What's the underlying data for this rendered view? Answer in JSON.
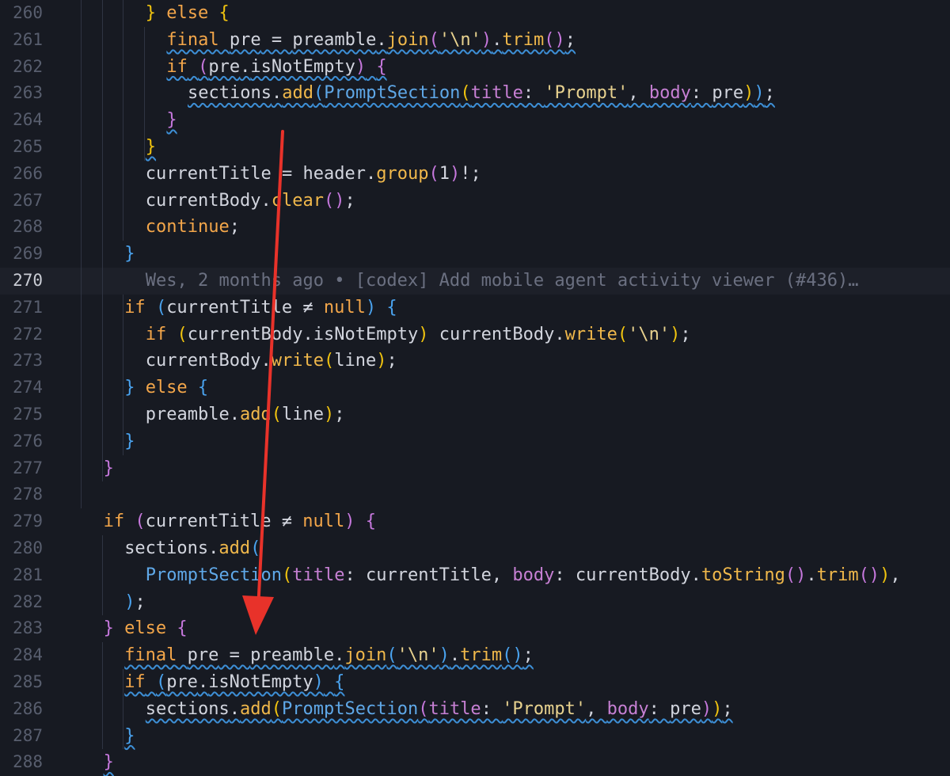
{
  "editor": {
    "current_line": 270,
    "lines": [
      {
        "num": "260",
        "indent": 3,
        "tokens": [
          [
            "br1",
            "}"
          ],
          [
            "sp",
            " "
          ],
          [
            "kw",
            "else"
          ],
          [
            "sp",
            " "
          ],
          [
            "br1",
            "{"
          ]
        ]
      },
      {
        "num": "261",
        "indent": 4,
        "sq": true,
        "tokens": [
          [
            "kw",
            "final"
          ],
          [
            "sp",
            " "
          ],
          [
            "id",
            "pre"
          ],
          [
            "op",
            " = "
          ],
          [
            "id",
            "preamble"
          ],
          [
            "punc",
            "."
          ],
          [
            "fn",
            "join"
          ],
          [
            "br2",
            "("
          ],
          [
            "str",
            "'\\n'"
          ],
          [
            "br2",
            ")"
          ],
          [
            "punc",
            "."
          ],
          [
            "fn",
            "trim"
          ],
          [
            "br2",
            "()"
          ],
          [
            "punc",
            ";"
          ]
        ]
      },
      {
        "num": "262",
        "indent": 4,
        "sq": true,
        "tokens": [
          [
            "kw",
            "if"
          ],
          [
            "sp",
            " "
          ],
          [
            "br2",
            "("
          ],
          [
            "id",
            "pre"
          ],
          [
            "punc",
            "."
          ],
          [
            "id",
            "isNotEmpty"
          ],
          [
            "br2",
            ")"
          ],
          [
            "sp",
            " "
          ],
          [
            "br2",
            "{"
          ]
        ]
      },
      {
        "num": "263",
        "indent": 5,
        "sq": true,
        "tokens": [
          [
            "id",
            "sections"
          ],
          [
            "punc",
            "."
          ],
          [
            "fn",
            "add"
          ],
          [
            "br3",
            "("
          ],
          [
            "type",
            "PromptSection"
          ],
          [
            "br1",
            "("
          ],
          [
            "prop",
            "title"
          ],
          [
            "punc",
            ": "
          ],
          [
            "str",
            "'Prompt'"
          ],
          [
            "punc",
            ", "
          ],
          [
            "prop",
            "body"
          ],
          [
            "punc",
            ": "
          ],
          [
            "id",
            "pre"
          ],
          [
            "br1",
            ")"
          ],
          [
            "br3",
            ")"
          ],
          [
            "punc",
            ";"
          ]
        ]
      },
      {
        "num": "264",
        "indent": 4,
        "sq": true,
        "tokens": [
          [
            "br2",
            "}"
          ]
        ]
      },
      {
        "num": "265",
        "indent": 3,
        "sq": true,
        "tokens": [
          [
            "br1",
            "}"
          ]
        ]
      },
      {
        "num": "266",
        "indent": 3,
        "tokens": [
          [
            "id",
            "currentTitle"
          ],
          [
            "op",
            " = "
          ],
          [
            "id",
            "header"
          ],
          [
            "punc",
            "."
          ],
          [
            "fn",
            "group"
          ],
          [
            "br2",
            "("
          ],
          [
            "id",
            "1"
          ],
          [
            "br2",
            ")"
          ],
          [
            "punc",
            "!;"
          ]
        ]
      },
      {
        "num": "267",
        "indent": 3,
        "tokens": [
          [
            "id",
            "currentBody"
          ],
          [
            "punc",
            "."
          ],
          [
            "fn",
            "clear"
          ],
          [
            "br2",
            "()"
          ],
          [
            "punc",
            ";"
          ]
        ]
      },
      {
        "num": "268",
        "indent": 3,
        "tokens": [
          [
            "kw",
            "continue"
          ],
          [
            "punc",
            ";"
          ]
        ]
      },
      {
        "num": "269",
        "indent": 2,
        "tokens": [
          [
            "br3",
            "}"
          ]
        ]
      },
      {
        "num": "270",
        "indent": 3,
        "tokens": [
          [
            "blame",
            "Wes, 2 months ago • [codex] Add mobile agent activity viewer (#436)…"
          ]
        ]
      },
      {
        "num": "271",
        "indent": 2,
        "tokens": [
          [
            "kw",
            "if"
          ],
          [
            "sp",
            " "
          ],
          [
            "br3",
            "("
          ],
          [
            "id",
            "currentTitle"
          ],
          [
            "op",
            " ≠ "
          ],
          [
            "kw",
            "null"
          ],
          [
            "br3",
            ")"
          ],
          [
            "sp",
            " "
          ],
          [
            "br3",
            "{"
          ]
        ]
      },
      {
        "num": "272",
        "indent": 3,
        "tokens": [
          [
            "kw",
            "if"
          ],
          [
            "sp",
            " "
          ],
          [
            "br1",
            "("
          ],
          [
            "id",
            "currentBody"
          ],
          [
            "punc",
            "."
          ],
          [
            "id",
            "isNotEmpty"
          ],
          [
            "br1",
            ")"
          ],
          [
            "sp",
            " "
          ],
          [
            "id",
            "currentBody"
          ],
          [
            "punc",
            "."
          ],
          [
            "fn",
            "write"
          ],
          [
            "br1",
            "("
          ],
          [
            "str",
            "'\\n'"
          ],
          [
            "br1",
            ")"
          ],
          [
            "punc",
            ";"
          ]
        ]
      },
      {
        "num": "273",
        "indent": 3,
        "tokens": [
          [
            "id",
            "currentBody"
          ],
          [
            "punc",
            "."
          ],
          [
            "fn",
            "write"
          ],
          [
            "br1",
            "("
          ],
          [
            "id",
            "line"
          ],
          [
            "br1",
            ")"
          ],
          [
            "punc",
            ";"
          ]
        ]
      },
      {
        "num": "274",
        "indent": 2,
        "tokens": [
          [
            "br3",
            "}"
          ],
          [
            "sp",
            " "
          ],
          [
            "kw",
            "else"
          ],
          [
            "sp",
            " "
          ],
          [
            "br3",
            "{"
          ]
        ]
      },
      {
        "num": "275",
        "indent": 3,
        "tokens": [
          [
            "id",
            "preamble"
          ],
          [
            "punc",
            "."
          ],
          [
            "fn",
            "add"
          ],
          [
            "br1",
            "("
          ],
          [
            "id",
            "line"
          ],
          [
            "br1",
            ")"
          ],
          [
            "punc",
            ";"
          ]
        ]
      },
      {
        "num": "276",
        "indent": 2,
        "tokens": [
          [
            "br3",
            "}"
          ]
        ]
      },
      {
        "num": "277",
        "indent": 1,
        "tokens": [
          [
            "br2",
            "}"
          ]
        ]
      },
      {
        "num": "278",
        "indent": 0,
        "tokens": []
      },
      {
        "num": "279",
        "indent": 1,
        "tokens": [
          [
            "kw",
            "if"
          ],
          [
            "sp",
            " "
          ],
          [
            "br2",
            "("
          ],
          [
            "id",
            "currentTitle"
          ],
          [
            "op",
            " ≠ "
          ],
          [
            "kw",
            "null"
          ],
          [
            "br2",
            ")"
          ],
          [
            "sp",
            " "
          ],
          [
            "br2",
            "{"
          ]
        ]
      },
      {
        "num": "280",
        "indent": 2,
        "tokens": [
          [
            "id",
            "sections"
          ],
          [
            "punc",
            "."
          ],
          [
            "fn",
            "add"
          ],
          [
            "br3",
            "("
          ]
        ]
      },
      {
        "num": "281",
        "indent": 3,
        "tokens": [
          [
            "type",
            "PromptSection"
          ],
          [
            "br1",
            "("
          ],
          [
            "prop",
            "title"
          ],
          [
            "punc",
            ": "
          ],
          [
            "id",
            "currentTitle"
          ],
          [
            "punc",
            ", "
          ],
          [
            "prop",
            "body"
          ],
          [
            "punc",
            ": "
          ],
          [
            "id",
            "currentBody"
          ],
          [
            "punc",
            "."
          ],
          [
            "fn",
            "toString"
          ],
          [
            "br2",
            "()"
          ],
          [
            "punc",
            "."
          ],
          [
            "fn",
            "trim"
          ],
          [
            "br2",
            "()"
          ],
          [
            "br1",
            ")"
          ],
          [
            "punc",
            ","
          ]
        ]
      },
      {
        "num": "282",
        "indent": 2,
        "tokens": [
          [
            "br3",
            ")"
          ],
          [
            "punc",
            ";"
          ]
        ]
      },
      {
        "num": "283",
        "indent": 1,
        "tokens": [
          [
            "br2",
            "}"
          ],
          [
            "sp",
            " "
          ],
          [
            "kw",
            "else"
          ],
          [
            "sp",
            " "
          ],
          [
            "br2",
            "{"
          ]
        ]
      },
      {
        "num": "284",
        "indent": 2,
        "sq": true,
        "tokens": [
          [
            "kw",
            "final"
          ],
          [
            "sp",
            " "
          ],
          [
            "id",
            "pre"
          ],
          [
            "op",
            " = "
          ],
          [
            "id",
            "preamble"
          ],
          [
            "punc",
            "."
          ],
          [
            "fn",
            "join"
          ],
          [
            "br3",
            "("
          ],
          [
            "str",
            "'\\n'"
          ],
          [
            "br3",
            ")"
          ],
          [
            "punc",
            "."
          ],
          [
            "fn",
            "trim"
          ],
          [
            "br3",
            "()"
          ],
          [
            "punc",
            ";"
          ]
        ]
      },
      {
        "num": "285",
        "indent": 2,
        "sq": true,
        "tokens": [
          [
            "kw",
            "if"
          ],
          [
            "sp",
            " "
          ],
          [
            "br3",
            "("
          ],
          [
            "id",
            "pre"
          ],
          [
            "punc",
            "."
          ],
          [
            "id",
            "isNotEmpty"
          ],
          [
            "br3",
            ")"
          ],
          [
            "sp",
            " "
          ],
          [
            "br3",
            "{"
          ]
        ]
      },
      {
        "num": "286",
        "indent": 3,
        "sq": true,
        "tokens": [
          [
            "id",
            "sections"
          ],
          [
            "punc",
            "."
          ],
          [
            "fn",
            "add"
          ],
          [
            "br1",
            "("
          ],
          [
            "type",
            "PromptSection"
          ],
          [
            "br2",
            "("
          ],
          [
            "prop",
            "title"
          ],
          [
            "punc",
            ": "
          ],
          [
            "str",
            "'Prompt'"
          ],
          [
            "punc",
            ", "
          ],
          [
            "prop",
            "body"
          ],
          [
            "punc",
            ": "
          ],
          [
            "id",
            "pre"
          ],
          [
            "br2",
            ")"
          ],
          [
            "br1",
            ")"
          ],
          [
            "punc",
            ";"
          ]
        ]
      },
      {
        "num": "287",
        "indent": 2,
        "sq": true,
        "tokens": [
          [
            "br3",
            "}"
          ]
        ]
      },
      {
        "num": "288",
        "indent": 1,
        "sq": true,
        "tokens": [
          [
            "br2",
            "}"
          ]
        ]
      }
    ]
  },
  "colors": {
    "background": "#171a22",
    "annotation_arrow": "#e8322a"
  }
}
